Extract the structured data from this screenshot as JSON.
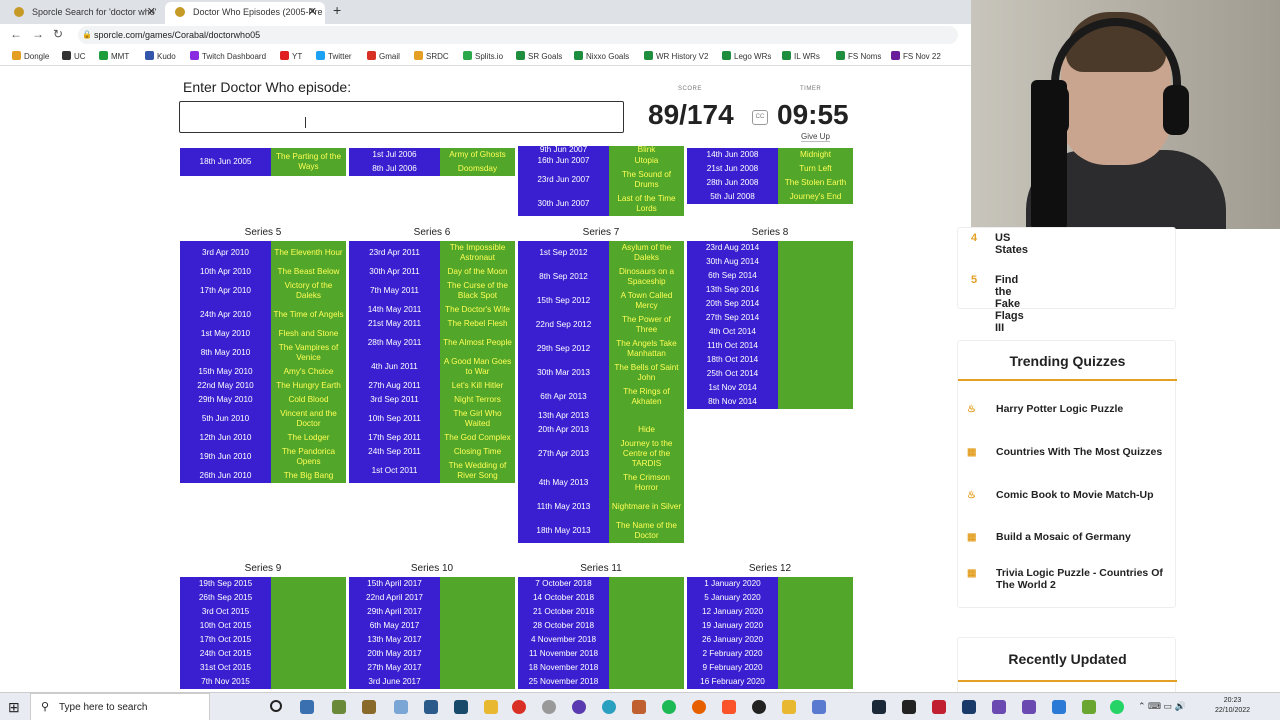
{
  "browser": {
    "tabs": [
      {
        "title": "Sporcle Search for 'doctor who'",
        "active": false
      },
      {
        "title": "Doctor Who Episodes (2005-Pre",
        "active": true
      }
    ],
    "url": "sporcle.com/games/Corabal/doctorwho05",
    "bookmarks": [
      "Dongle",
      "UC",
      "MMT",
      "Kudo",
      "Twitch Dashboard",
      "YT",
      "Twitter",
      "Gmail",
      "SRDC",
      "Splits.io",
      "SR Goals",
      "Nixxo Goals",
      "WR History V2",
      "Lego WRs",
      "IL WRs",
      "FS Noms",
      "FS Nov 22"
    ]
  },
  "quiz": {
    "prompt": "Enter Doctor Who episode:",
    "answer_value": "",
    "score_label": "SCORE",
    "timer_label": "TIMER",
    "score": "89/174",
    "cc_label": "CC",
    "timer": "09:55",
    "give_up": "Give Up"
  },
  "tables": {
    "s1": {
      "rows": [
        [
          "18th Jun 2005",
          "The Parting of the Ways"
        ]
      ]
    },
    "s2": {
      "rows": [
        [
          "1st Jul 2006",
          "Army of Ghosts"
        ],
        [
          "8th Jul 2006",
          "Doomsday"
        ]
      ]
    },
    "s3": {
      "rows": [
        [
          "9th Jun 2007",
          "Blink"
        ],
        [
          "16th Jun 2007",
          "Utopia"
        ],
        [
          "23rd Jun 2007",
          "The Sound of Drums"
        ],
        [
          "30th Jun 2007",
          "Last of the Time Lords"
        ]
      ]
    },
    "s4": {
      "rows": [
        [
          "14th Jun 2008",
          "Midnight"
        ],
        [
          "21st Jun 2008",
          "Turn Left"
        ],
        [
          "28th Jun 2008",
          "The Stolen Earth"
        ],
        [
          "5th Jul 2008",
          "Journey's End"
        ]
      ]
    },
    "s5": {
      "title": "Series 5",
      "rows": [
        [
          "3rd Apr 2010",
          "The Eleventh Hour"
        ],
        [
          "10th Apr 2010",
          "The Beast Below"
        ],
        [
          "17th Apr 2010",
          "Victory of the Daleks"
        ],
        [
          "24th Apr 2010",
          "The Time of Angels"
        ],
        [
          "1st May 2010",
          "Flesh and Stone"
        ],
        [
          "8th May 2010",
          "The Vampires of Venice"
        ],
        [
          "15th May 2010",
          "Amy's Choice"
        ],
        [
          "22nd May 2010",
          "The Hungry Earth"
        ],
        [
          "29th May 2010",
          "Cold Blood"
        ],
        [
          "5th Jun 2010",
          "Vincent and the Doctor"
        ],
        [
          "12th Jun 2010",
          "The Lodger"
        ],
        [
          "19th Jun 2010",
          "The Pandorica Opens"
        ],
        [
          "26th Jun 2010",
          "The Big Bang"
        ]
      ]
    },
    "s6": {
      "title": "Series 6",
      "rows": [
        [
          "23rd Apr 2011",
          "The Impossible Astronaut"
        ],
        [
          "30th Apr 2011",
          "Day of the Moon"
        ],
        [
          "7th May 2011",
          "The Curse of the Black Spot"
        ],
        [
          "14th May 2011",
          "The Doctor's Wife"
        ],
        [
          "21st May 2011",
          "The Rebel Flesh"
        ],
        [
          "28th May 2011",
          "The Almost People"
        ],
        [
          "4th Jun 2011",
          "A Good Man Goes to War"
        ],
        [
          "27th Aug 2011",
          "Let's Kill Hitler"
        ],
        [
          "3rd Sep 2011",
          "Night Terrors"
        ],
        [
          "10th Sep 2011",
          "The Girl Who Waited"
        ],
        [
          "17th Sep 2011",
          "The God Complex"
        ],
        [
          "24th Sep 2011",
          "Closing Time"
        ],
        [
          "1st Oct 2011",
          "The Wedding of River Song"
        ]
      ]
    },
    "s7": {
      "title": "Series 7",
      "rows": [
        [
          "1st Sep 2012",
          "Asylum of the Daleks"
        ],
        [
          "8th Sep 2012",
          "Dinosaurs on a Spaceship"
        ],
        [
          "15th Sep 2012",
          "A Town Called Mercy"
        ],
        [
          "22nd Sep 2012",
          "The Power of Three"
        ],
        [
          "29th Sep 2012",
          "The Angels Take Manhattan"
        ],
        [
          "30th Mar 2013",
          "The Bells of Saint John"
        ],
        [
          "6th Apr 2013",
          "The Rings of Akhaten"
        ],
        [
          "13th Apr 2013",
          ""
        ],
        [
          "20th Apr 2013",
          "Hide"
        ],
        [
          "27th Apr 2013",
          "Journey to the Centre of the TARDIS"
        ],
        [
          "4th May 2013",
          "The Crimson Horror"
        ],
        [
          "11th May 2013",
          "Nightmare in Silver"
        ],
        [
          "18th May 2013",
          "The Name of the Doctor"
        ]
      ]
    },
    "s8": {
      "title": "Series 8",
      "rows": [
        [
          "23rd Aug 2014",
          ""
        ],
        [
          "30th Aug 2014",
          ""
        ],
        [
          "6th Sep 2014",
          ""
        ],
        [
          "13th Sep 2014",
          ""
        ],
        [
          "20th Sep 2014",
          ""
        ],
        [
          "27th Sep 2014",
          ""
        ],
        [
          "4th Oct 2014",
          ""
        ],
        [
          "11th Oct 2014",
          ""
        ],
        [
          "18th Oct 2014",
          ""
        ],
        [
          "25th Oct 2014",
          ""
        ],
        [
          "1st Nov 2014",
          ""
        ],
        [
          "8th Nov 2014",
          ""
        ]
      ]
    },
    "s9": {
      "title": "Series 9",
      "rows": [
        [
          "19th Sep 2015",
          ""
        ],
        [
          "26th Sep 2015",
          ""
        ],
        [
          "3rd Oct 2015",
          ""
        ],
        [
          "10th Oct 2015",
          ""
        ],
        [
          "17th Oct 2015",
          ""
        ],
        [
          "24th Oct 2015",
          ""
        ],
        [
          "31st Oct 2015",
          ""
        ],
        [
          "7th Nov 2015",
          ""
        ]
      ]
    },
    "s10": {
      "title": "Series 10",
      "rows": [
        [
          "15th April 2017",
          ""
        ],
        [
          "22nd April 2017",
          ""
        ],
        [
          "29th April 2017",
          ""
        ],
        [
          "6th May 2017",
          ""
        ],
        [
          "13th May 2017",
          ""
        ],
        [
          "20th May 2017",
          ""
        ],
        [
          "27th May 2017",
          ""
        ],
        [
          "3rd June 2017",
          ""
        ]
      ]
    },
    "s11": {
      "title": "Series 11",
      "rows": [
        [
          "7 October 2018",
          ""
        ],
        [
          "14 October 2018",
          ""
        ],
        [
          "21 October 2018",
          ""
        ],
        [
          "28 October 2018",
          ""
        ],
        [
          "4 November 2018",
          ""
        ],
        [
          "11 November 2018",
          ""
        ],
        [
          "18 November 2018",
          ""
        ],
        [
          "25 November 2018",
          ""
        ]
      ]
    },
    "s12": {
      "title": "Series 12",
      "rows": [
        [
          "1 January 2020",
          ""
        ],
        [
          "5 January 2020",
          ""
        ],
        [
          "12 January 2020",
          ""
        ],
        [
          "19 January 2020",
          ""
        ],
        [
          "26 January 2020",
          ""
        ],
        [
          "2 February 2020",
          ""
        ],
        [
          "9 February 2020",
          ""
        ],
        [
          "16 February 2020",
          ""
        ]
      ]
    }
  },
  "sidebar": {
    "ranked": [
      {
        "num": "4",
        "title": "US States"
      },
      {
        "num": "5",
        "title": "Find the Fake Flags III"
      }
    ],
    "trending_title": "Trending Quizzes",
    "trending": [
      "Harry Potter Logic Puzzle",
      "Countries With The Most Quizzes",
      "Comic Book to Movie Match-Up",
      "Build a Mosaic of Germany",
      "Trivia Logic Puzzle - Countries Of The World 2"
    ],
    "recent_title": "Recently Updated"
  },
  "taskbar": {
    "search_placeholder": "Type here to search",
    "time": "20:23",
    "date": "22/10/2022"
  },
  "colors": {
    "date_cell": "#3a1fd0",
    "episode_cell": "#52a62a",
    "episode_text": "#ffff55",
    "accent": "#e3a024"
  }
}
